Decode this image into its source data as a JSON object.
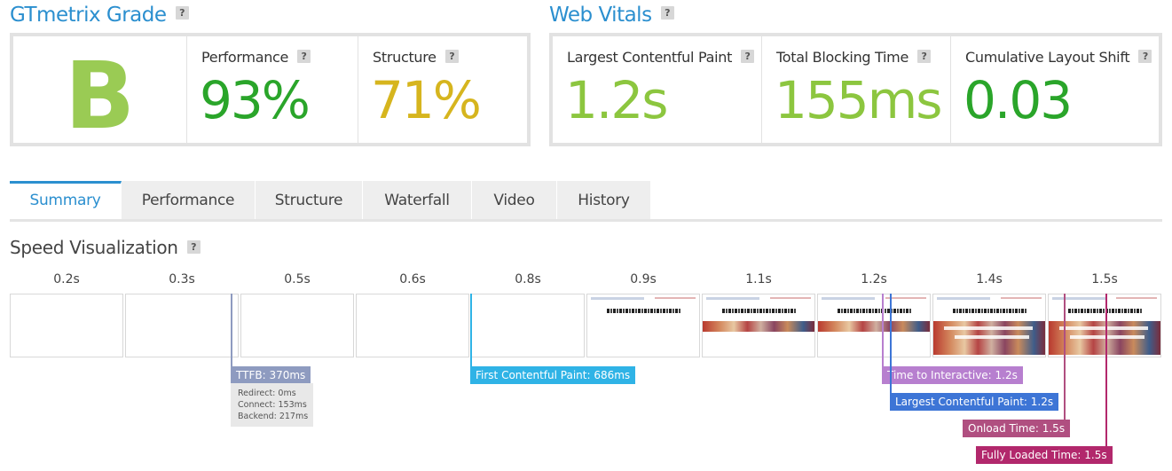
{
  "gtmetrix": {
    "title": "GTmetrix Grade",
    "help": "?",
    "grade": "B",
    "performance": {
      "label": "Performance",
      "value": "93%",
      "color": "#2aa52a"
    },
    "structure": {
      "label": "Structure",
      "value": "71%",
      "color": "#d6b51e"
    }
  },
  "web_vitals": {
    "title": "Web Vitals",
    "help": "?",
    "lcp": {
      "label": "Largest Contentful Paint",
      "value": "1.2s",
      "color": "#8cc63f"
    },
    "tbt": {
      "label": "Total Blocking Time",
      "value": "155ms",
      "color": "#8cc63f"
    },
    "cls": {
      "label": "Cumulative Layout Shift",
      "value": "0.03",
      "color": "#2aa52a"
    }
  },
  "tabs": [
    {
      "label": "Summary",
      "active": true
    },
    {
      "label": "Performance",
      "active": false
    },
    {
      "label": "Structure",
      "active": false
    },
    {
      "label": "Waterfall",
      "active": false
    },
    {
      "label": "Video",
      "active": false
    },
    {
      "label": "History",
      "active": false
    }
  ],
  "speed_visualization": {
    "title": "Speed Visualization",
    "help": "?",
    "frames": [
      {
        "time": "0.2s",
        "content": "blank"
      },
      {
        "time": "0.3s",
        "content": "blank"
      },
      {
        "time": "0.5s",
        "content": "blank"
      },
      {
        "time": "0.6s",
        "content": "blank"
      },
      {
        "time": "0.8s",
        "content": "blank"
      },
      {
        "time": "0.9s",
        "content": "header"
      },
      {
        "time": "1.1s",
        "content": "banner"
      },
      {
        "time": "1.2s",
        "content": "banner"
      },
      {
        "time": "1.4s",
        "content": "full"
      },
      {
        "time": "1.5s",
        "content": "full"
      }
    ],
    "ttfb": {
      "label": "TTFB: 370ms",
      "color": "#8e9bc0",
      "redirect": "Redirect: 0ms",
      "connect": "Connect: 153ms",
      "backend": "Backend: 217ms"
    },
    "markers": {
      "fcp": {
        "label": "First Contentful Paint: 686ms",
        "color": "#2fb3e6"
      },
      "tti": {
        "label": "Time to Interactive: 1.2s",
        "color": "#b77fcf"
      },
      "lcp": {
        "label": "Largest Contentful Paint: 1.2s",
        "color": "#3d75d6"
      },
      "onload": {
        "label": "Onload Time: 1.5s",
        "color": "#b04f80"
      },
      "fully_loaded": {
        "label": "Fully Loaded Time: 1.5s",
        "color": "#b2286c"
      }
    }
  }
}
